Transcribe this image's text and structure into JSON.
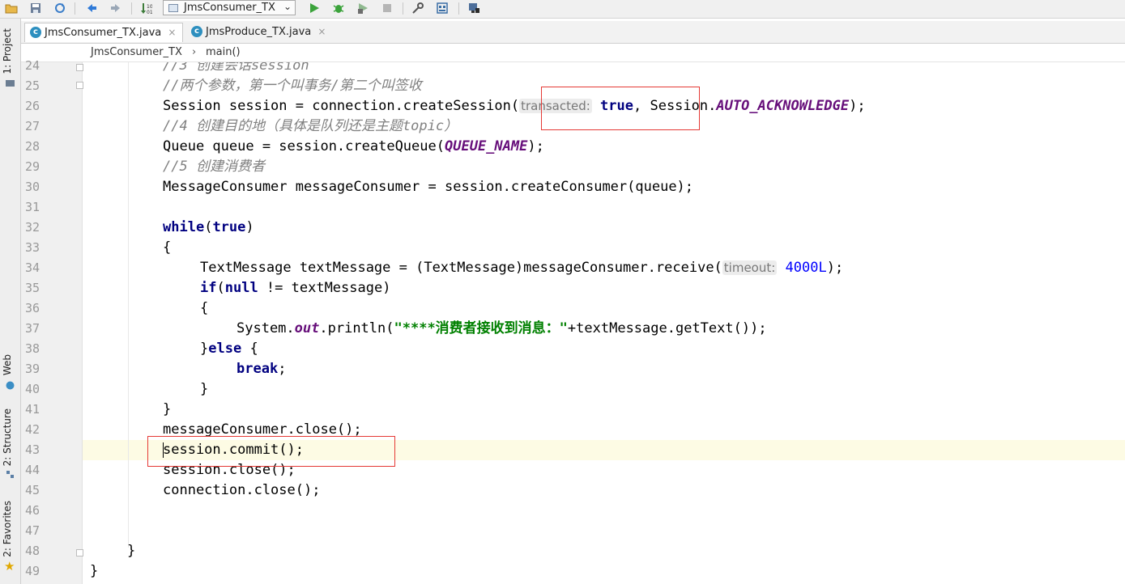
{
  "toolbar": {
    "run_config": "JmsConsumer_TX",
    "icons": [
      "folder-open-icon",
      "save-icon",
      "sync-icon",
      "back-icon",
      "forward-icon",
      "build-icon",
      "run-icon",
      "debug-icon",
      "coverage-icon",
      "stop-icon",
      "structure-icon",
      "project-structure-icon",
      "sdk-icon"
    ]
  },
  "left_strip": {
    "project": "1: Project",
    "web": "Web",
    "structure": "2: Structure",
    "favorites": "2: Favorites"
  },
  "tabs": [
    {
      "label": "JmsConsumer_TX.java",
      "close": "×",
      "active": true
    },
    {
      "label": "JmsProduce_TX.java",
      "close": "×",
      "active": false
    }
  ],
  "breadcrumb": {
    "class": "JmsConsumer_TX",
    "separator": "›",
    "method": "main()"
  },
  "code": {
    "line_numbers": [
      "24",
      "25",
      "26",
      "27",
      "28",
      "29",
      "30",
      "31",
      "32",
      "33",
      "34",
      "35",
      "36",
      "37",
      "38",
      "39",
      "40",
      "41",
      "42",
      "43",
      "44",
      "45",
      "46",
      "47",
      "48",
      "49"
    ],
    "current_line": "43",
    "l24": "//3 创建会话session",
    "l25": "//两个参数，第一个叫事务/第二个叫签收",
    "l26": {
      "a": "Session session = connection.createSession(",
      "hint": "transacted:",
      "kw": "true",
      "b": ", Session.",
      "const": "AUTO_ACKNOWLEDGE",
      "c": ");"
    },
    "l27": "//4 创建目的地（具体是队列还是主题topic）",
    "l28": {
      "a": "Queue queue = session.createQueue(",
      "const": "QUEUE_NAME",
      "b": ");"
    },
    "l29": "//5 创建消费者",
    "l30": "MessageConsumer messageConsumer = session.createConsumer(queue);",
    "l32": {
      "kw": "while",
      "a": "(",
      "kw2": "true",
      "b": ")"
    },
    "l33": "{",
    "l34": {
      "a": "TextMessage textMessage = (TextMessage)messageConsumer.receive(",
      "hint": "timeout:",
      "num": "4000L",
      "b": ");"
    },
    "l35": {
      "kw": "if",
      "a": "(",
      "kw2": "null",
      "b": " != textMessage)"
    },
    "l36": "{",
    "l37": {
      "a": "System.",
      "field": "out",
      "b": ".println(",
      "str": "\"****消费者接收到消息：\"",
      "c": "+textMessage.getText());"
    },
    "l38": {
      "a": "}",
      "kw": "else",
      "b": " {"
    },
    "l39": {
      "kw": "break",
      "a": ";"
    },
    "l40": "}",
    "l41": "}",
    "l42": "messageConsumer.close();",
    "l43": "session.commit();",
    "l44": "session.close();",
    "l45": "connection.close();",
    "l48": "}",
    "l49": "}"
  },
  "highlight_color": "#e53935"
}
